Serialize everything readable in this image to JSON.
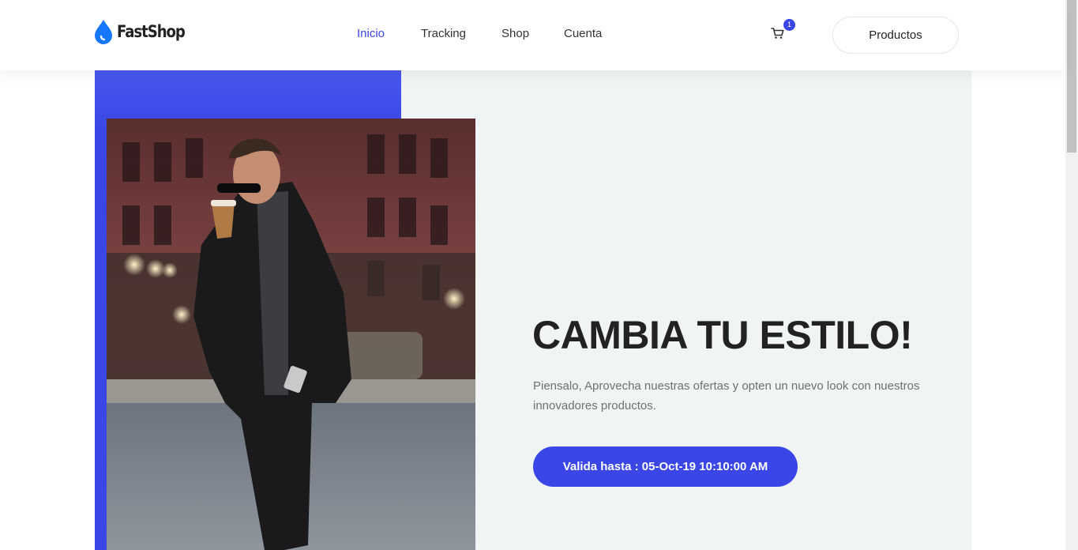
{
  "brand": {
    "name": "FastShop",
    "accent": "#3a47e6",
    "logo_icon": "drop-icon"
  },
  "nav": {
    "items": [
      {
        "label": "Inicio",
        "active": true
      },
      {
        "label": "Tracking",
        "active": false
      },
      {
        "label": "Shop",
        "active": false
      },
      {
        "label": "Cuenta",
        "active": false
      }
    ]
  },
  "cart": {
    "icon": "cart-icon",
    "count": "1"
  },
  "header_button": {
    "label": "Productos"
  },
  "hero": {
    "title": "CAMBIA TU ESTILO!",
    "text": "Piensalo, Aprovecha nuestras ofertas y opten un nuevo look con nuestros innovadores productos.",
    "button_label": "Valida hasta : 05-Oct-19 10:10:00 AM",
    "image": "man-walking-with-coffee-photo"
  }
}
